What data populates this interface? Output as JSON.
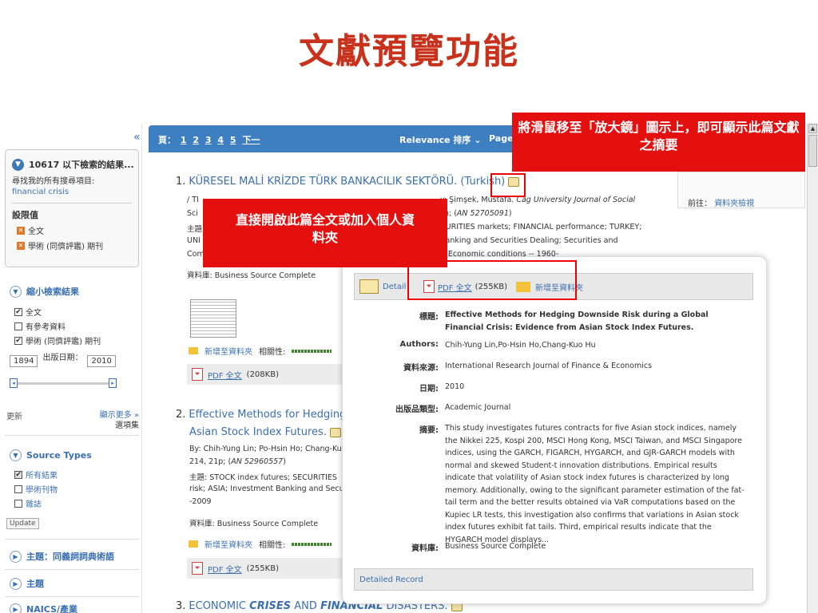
{
  "slide_title": "文獻預覽功能",
  "toolbar": {
    "page_label": "頁：",
    "pages": [
      "1",
      "2",
      "3",
      "4",
      "5"
    ],
    "next": "下一",
    "sort": "Relevance 排序 ⌄",
    "page_opts": "Page O"
  },
  "sidebar": {
    "collapse_glyph": "«",
    "search_count_head": "10617 以下檢索的結果...",
    "search_sub": "尋找我的所有搜尋項目:",
    "search_term": "financial crisis",
    "limiters_label": "設限值",
    "limiters": [
      "全文",
      "學術 (同儕評鑑) 期刊"
    ],
    "narrow_head": "縮小檢索結果",
    "checks": [
      {
        "label": "全文",
        "checked": "✔"
      },
      {
        "label": "有參考資料",
        "checked": ""
      },
      {
        "label": "學術 (同儕評鑑) 期刊",
        "checked": "✔"
      }
    ],
    "pub_date_label": "出版日期：",
    "date_from": "1894",
    "date_to": "2010",
    "update_small": "更新",
    "show_more": "顯示更多 »",
    "options": "選項集",
    "source_types_head": "Source Types",
    "source_checks": [
      {
        "label": "所有結果",
        "checked": "✔"
      },
      {
        "label": "學術刊物",
        "checked": ""
      },
      {
        "label": "雜誌",
        "checked": ""
      }
    ],
    "update_btn": "Update",
    "subject_thesaurus": "主題：同義詞詞典術語",
    "subject": "主題",
    "naics": "NAICS/產業"
  },
  "results": [
    {
      "num": "1.",
      "title": "KÜRESEL MALİ KRİZDE TÜRK BANKACILIK SEKTÖRÜ. (Turkish)",
      "line1_a": "/ TI",
      "line1_b": "y: Şimşek, Mustafa. ",
      "line1_journal": "Cag University Journal of Social",
      "line2_a": "Sci",
      "line2_b": "sh; (",
      "line2_an": "AN 52705091",
      "line2_c": ")",
      "line3_a": "主題",
      "line3_b": "CURITIES markets; FINANCIAL performance; TURKEY;",
      "line4_a": "UNI",
      "line4_b": "Banking and Securities Dealing; Securities and",
      "line5_a": "Com",
      "line5_b": "-- Economic conditions -- 1960-",
      "db_label": "資料庫:",
      "db": "Business Source Complete",
      "add_folder": "新增至資料夾",
      "relevance": "相關性:",
      "pdf": "PDF 全文",
      "pdf_size": "(208KB)"
    },
    {
      "num": "2.",
      "title_a": "Effective Methods for Hedging D",
      "title_b": "Asian Stock Index Futures.",
      "line1": "By: Chih-Yung Lin; Po-Hsin Ho; Chang-Kuo",
      "line2_a": "214, 21p; (",
      "line2_an": "AN 52960557",
      "line2_c": ")",
      "line3": "主題: STOCK index futures; SECURITIES",
      "line4": "risk; ASIA; Investment Banking and Secur",
      "line5": "-2009",
      "db_label": "資料庫:",
      "db": "Business Source Complete",
      "add_folder": "新增至資料夾",
      "relevance": "相關性:",
      "pdf": "PDF 全文",
      "pdf_size": "(255KB)"
    },
    {
      "num": "3.",
      "title_a": "ECONOMIC ",
      "title_b": "CRISES",
      "title_c": " AND ",
      "title_d": "FINANCIAL",
      "title_e": " DISASTERS."
    }
  ],
  "right_panel": {
    "goto": "前往：",
    "folder_view": "資料夾檢視"
  },
  "popup": {
    "detail": "Detail",
    "pdf": "PDF 全文",
    "pdf_size": "(255KB)",
    "add_folder": "新增至資料夾",
    "fields": [
      {
        "key": "標題:",
        "value": "Effective Methods for Hedging Downside Risk during a Global Financial Crisis: Evidence from Asian Stock Index Futures."
      },
      {
        "key": "Authors:",
        "value": "Chih-Yung Lin,Po-Hsin Ho,Chang-Kuo Hu"
      },
      {
        "key": "資料來源:",
        "value": "International Research Journal of Finance & Economics"
      },
      {
        "key": "日期:",
        "value": "2010"
      },
      {
        "key": "出版品類型:",
        "value": "Academic Journal"
      },
      {
        "key": "摘要:",
        "value": "This study investigates futures contracts for five Asian stock indices, namely the Nikkei 225, Kospi 200, MSCI Hong Kong, MSCI Taiwan, and MSCI Singapore indices, using the GARCH, FIGARCH, HYGARCH, and GJR-GARCH models with normal and skewed Student-t innovation distributions. Empirical results indicate that volatility of Asian stock index futures is characterized by long memory. Additionally, owing to the significant parameter estimation of the fat-tail term and the better results obtained via VaR computations based on the Kupiec LR tests, this investigation also confirms that variations in Asian stock index futures exhibit fat tails. Third, empirical results indicate that the HYGARCH model displays..."
      },
      {
        "key": "資料庫:",
        "value": "Business Source Complete"
      }
    ],
    "detailed_record": "Detailed Record"
  },
  "callouts": {
    "magnifier": "將滑鼠移至「放大鏡」圖示上，即可顯示此篇文獻之摘要",
    "fulltext": "直接開啟此篇全文或加入個人資料夾"
  }
}
